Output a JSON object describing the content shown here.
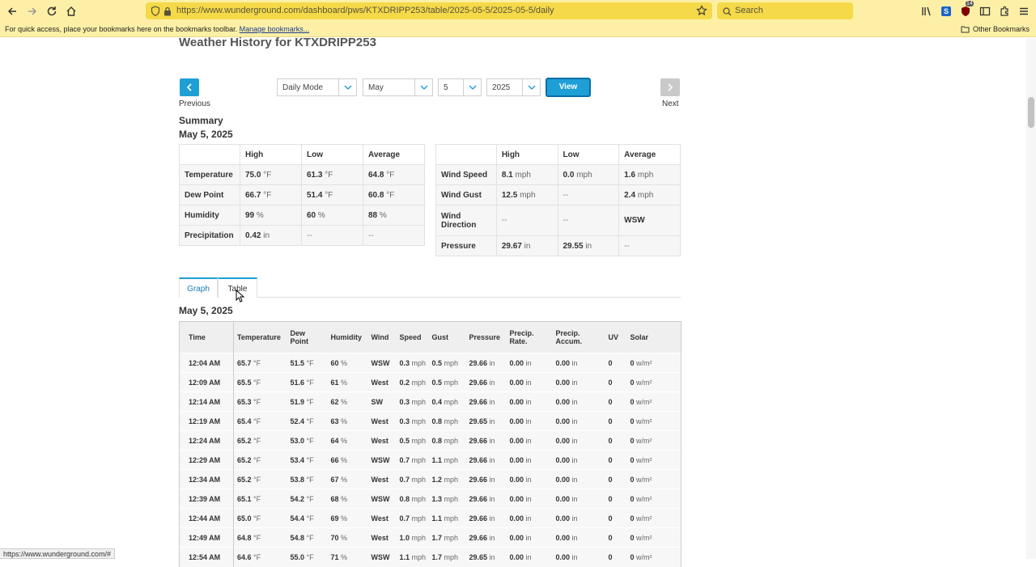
{
  "browser": {
    "url": "https://www.wunderground.com/dashboard/pws/KTXDRIPP253/table/2025-05-5/2025-05-5/daily",
    "search_placeholder": "Search",
    "bookmarks_text": "For quick access, place your bookmarks here on the bookmarks toolbar.",
    "manage_bookmarks": "Manage bookmarks...",
    "other_bookmarks": "Other Bookmarks",
    "badge_count": "14",
    "status_url": "https://www.wunderground.com/#",
    "toolbar_accent": "#fdf0a6"
  },
  "page": {
    "title": "Weather History for KTXDRIPP253",
    "prev_label": "Previous",
    "next_label": "Next",
    "mode_select": "Daily Mode",
    "month_select": "May",
    "day_select": "5",
    "year_select": "2025",
    "view_button": "View",
    "accent": "#1e9fd6"
  },
  "summary": {
    "title": "Summary",
    "date": "May 5, 2025",
    "headers": [
      "",
      "High",
      "Low",
      "Average"
    ],
    "left_rows": [
      {
        "label": "Temperature",
        "high": "75.0",
        "high_u": "°F",
        "low": "61.3",
        "low_u": "°F",
        "avg": "64.8",
        "avg_u": "°F"
      },
      {
        "label": "Dew Point",
        "high": "66.7",
        "high_u": "°F",
        "low": "51.4",
        "low_u": "°F",
        "avg": "60.8",
        "avg_u": "°F"
      },
      {
        "label": "Humidity",
        "high": "99",
        "high_u": "%",
        "low": "60",
        "low_u": "%",
        "avg": "88",
        "avg_u": "%"
      },
      {
        "label": "Precipitation",
        "high": "0.42",
        "high_u": "in",
        "low": "--",
        "low_u": "",
        "avg": "--",
        "avg_u": ""
      }
    ],
    "right_rows": [
      {
        "label": "Wind Speed",
        "high": "8.1",
        "high_u": "mph",
        "low": "0.0",
        "low_u": "mph",
        "avg": "1.6",
        "avg_u": "mph"
      },
      {
        "label": "Wind Gust",
        "high": "12.5",
        "high_u": "mph",
        "low": "--",
        "low_u": "",
        "avg": "2.4",
        "avg_u": "mph"
      },
      {
        "label": "Wind Direction",
        "high": "--",
        "high_u": "",
        "low": "--",
        "low_u": "",
        "avg": "WSW",
        "avg_u": ""
      },
      {
        "label": "Pressure",
        "high": "29.67",
        "high_u": "in",
        "low": "29.55",
        "low_u": "in",
        "avg": "--",
        "avg_u": ""
      }
    ]
  },
  "tabs": {
    "graph": "Graph",
    "table": "Table"
  },
  "observations": {
    "date": "May 5, 2025",
    "headers": [
      "Time",
      "Temperature",
      "Dew Point",
      "Humidity",
      "Wind",
      "Speed",
      "Gust",
      "Pressure",
      "Precip. Rate.",
      "Precip. Accum.",
      "UV",
      "Solar"
    ],
    "rows": [
      [
        "12:04 AM",
        "65.7",
        "51.5",
        "60",
        "WSW",
        "0.3",
        "0.5",
        "29.66",
        "0.00",
        "0.00",
        "0",
        "0"
      ],
      [
        "12:09 AM",
        "65.5",
        "51.6",
        "61",
        "West",
        "0.2",
        "0.5",
        "29.66",
        "0.00",
        "0.00",
        "0",
        "0"
      ],
      [
        "12:14 AM",
        "65.3",
        "51.9",
        "62",
        "SW",
        "0.3",
        "0.4",
        "29.66",
        "0.00",
        "0.00",
        "0",
        "0"
      ],
      [
        "12:19 AM",
        "65.4",
        "52.4",
        "63",
        "West",
        "0.3",
        "0.8",
        "29.65",
        "0.00",
        "0.00",
        "0",
        "0"
      ],
      [
        "12:24 AM",
        "65.2",
        "53.0",
        "64",
        "West",
        "0.5",
        "0.8",
        "29.66",
        "0.00",
        "0.00",
        "0",
        "0"
      ],
      [
        "12:29 AM",
        "65.2",
        "53.4",
        "66",
        "WSW",
        "0.7",
        "1.1",
        "29.66",
        "0.00",
        "0.00",
        "0",
        "0"
      ],
      [
        "12:34 AM",
        "65.2",
        "53.8",
        "67",
        "West",
        "0.7",
        "1.2",
        "29.66",
        "0.00",
        "0.00",
        "0",
        "0"
      ],
      [
        "12:39 AM",
        "65.1",
        "54.2",
        "68",
        "WSW",
        "0.8",
        "1.3",
        "29.66",
        "0.00",
        "0.00",
        "0",
        "0"
      ],
      [
        "12:44 AM",
        "65.0",
        "54.4",
        "69",
        "West",
        "0.7",
        "1.1",
        "29.66",
        "0.00",
        "0.00",
        "0",
        "0"
      ],
      [
        "12:49 AM",
        "64.8",
        "54.8",
        "70",
        "West",
        "1.0",
        "1.7",
        "29.66",
        "0.00",
        "0.00",
        "0",
        "0"
      ],
      [
        "12:54 AM",
        "64.6",
        "55.0",
        "71",
        "WSW",
        "1.1",
        "1.7",
        "29.65",
        "0.00",
        "0.00",
        "0",
        "0"
      ]
    ],
    "units": [
      "",
      "°F",
      "°F",
      "%",
      "",
      "mph",
      "mph",
      "in",
      "in",
      "in",
      "",
      "w/m²"
    ]
  }
}
